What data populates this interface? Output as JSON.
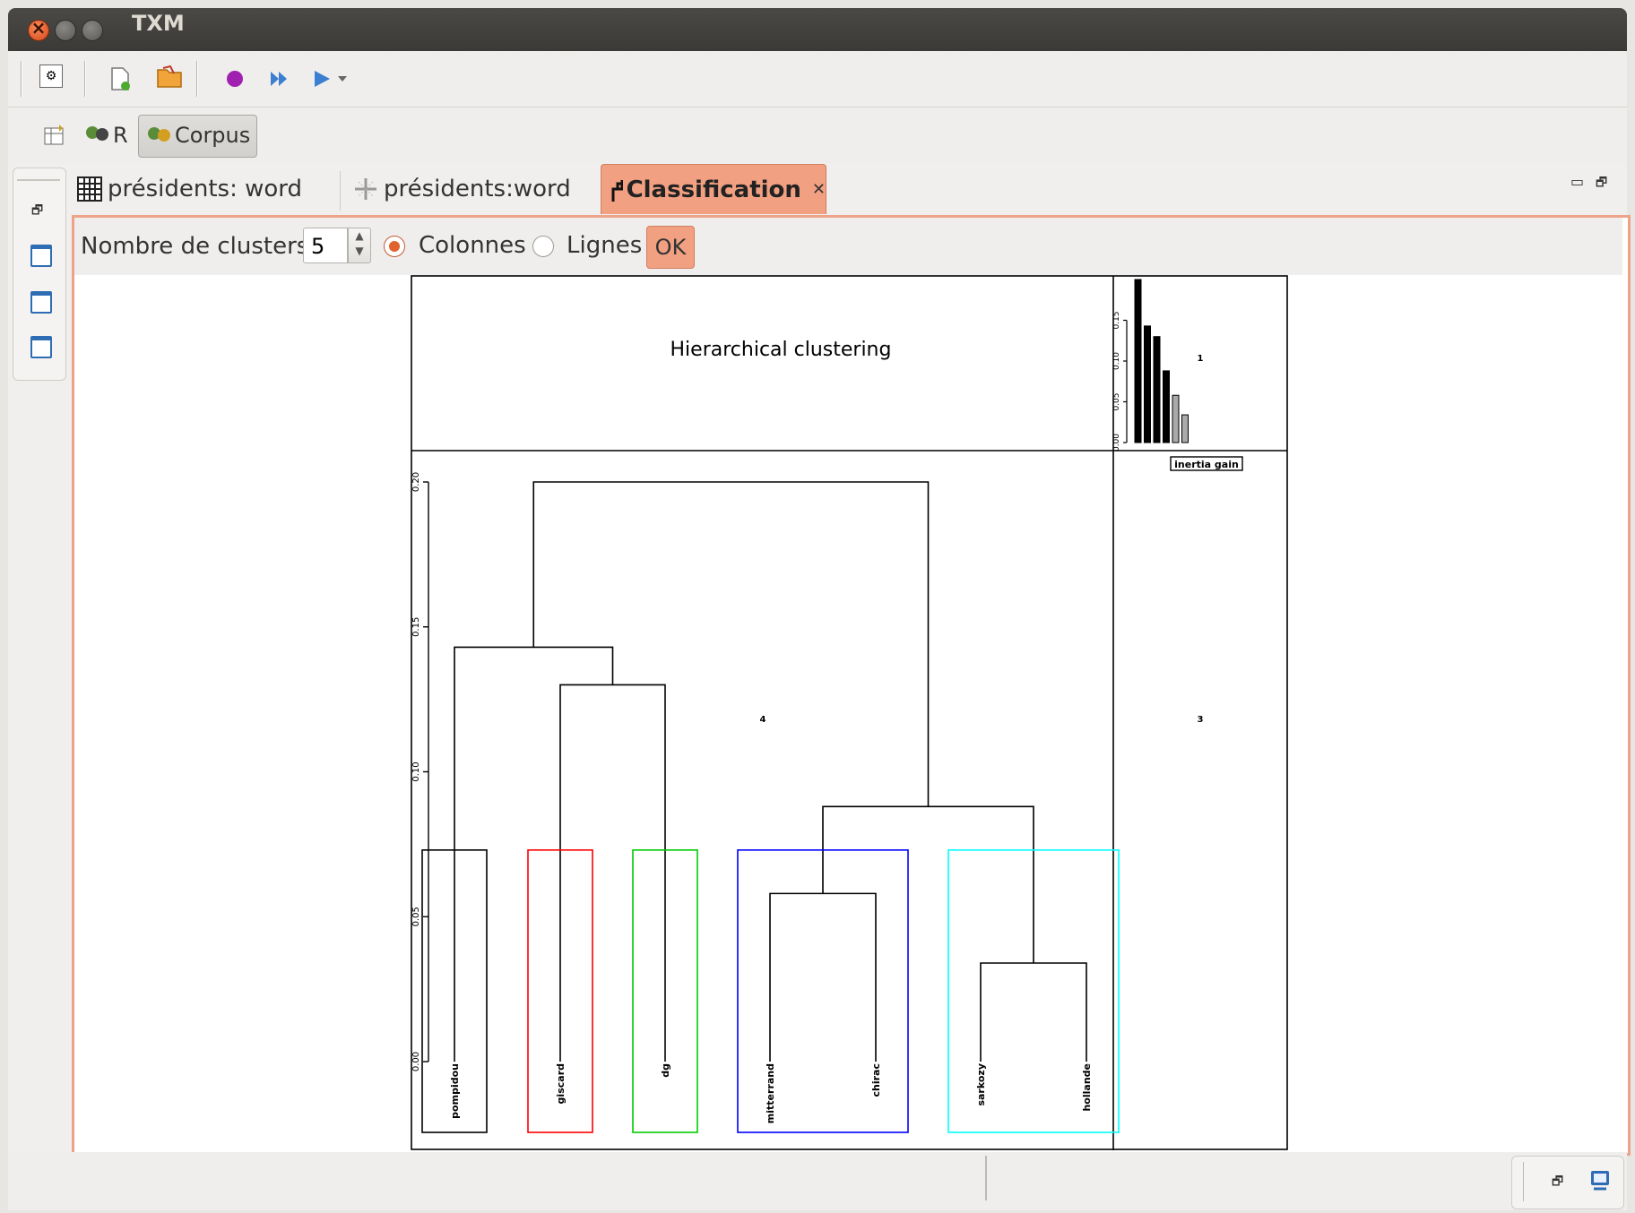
{
  "window": {
    "title": "TXM"
  },
  "perspectives": {
    "r_label": "R",
    "corpus_label": "Corpus"
  },
  "tabs": [
    {
      "label": "présidents: word"
    },
    {
      "label": "présidents:word"
    },
    {
      "label": "Classification"
    }
  ],
  "controls": {
    "clusters_label": "Nombre de clusters",
    "clusters_value": "5",
    "radio_columns": "Colonnes",
    "radio_rows": "Lignes",
    "ok_label": "OK",
    "selected_radio": "Colonnes"
  },
  "chart_data": [
    {
      "type": "dendrogram",
      "title": "Hierarchical clustering",
      "leaves": [
        "pompidou",
        "giscard",
        "dg",
        "mitterrand",
        "chirac",
        "sarkozy",
        "hollande"
      ],
      "merges": [
        {
          "left": "sarkozy",
          "right": "hollande",
          "height": 0.034
        },
        {
          "left": "mitterrand",
          "right": "chirac",
          "height": 0.058
        },
        {
          "left": "mitterrand+chirac",
          "right": "sarkozy+hollande",
          "height": 0.088
        },
        {
          "left": "giscard",
          "right": "dg",
          "height": 0.13
        },
        {
          "left": "pompidou",
          "right": "giscard+dg",
          "height": 0.143
        },
        {
          "left": "pompidou+giscard+dg",
          "right": "mitterrand+chirac+sarkozy+hollande",
          "height": 0.2
        }
      ],
      "clusters": [
        {
          "members": [
            "pompidou"
          ],
          "color": "#000000"
        },
        {
          "members": [
            "giscard"
          ],
          "color": "#ff0000"
        },
        {
          "members": [
            "dg"
          ],
          "color": "#00cc00"
        },
        {
          "members": [
            "mitterrand",
            "chirac"
          ],
          "color": "#0000ff"
        },
        {
          "members": [
            "sarkozy",
            "hollande"
          ],
          "color": "#00ffff"
        }
      ],
      "cut_height": 0.073,
      "ylim": [
        0,
        0.2
      ],
      "yticks": [
        "0.00",
        "0.05",
        "0.10",
        "0.15",
        "0.20"
      ],
      "panel_labels": [
        "1",
        "3",
        "4"
      ]
    },
    {
      "type": "bar",
      "title": "inertia gain",
      "values": [
        0.2,
        0.143,
        0.13,
        0.088,
        0.058,
        0.034
      ],
      "colors": [
        "#000000",
        "#000000",
        "#000000",
        "#000000",
        "#aaaaaa",
        "#aaaaaa"
      ],
      "ylim": [
        0,
        0.2
      ],
      "yticks": [
        "0.00",
        "0.05",
        "0.10",
        "0.15"
      ]
    }
  ]
}
